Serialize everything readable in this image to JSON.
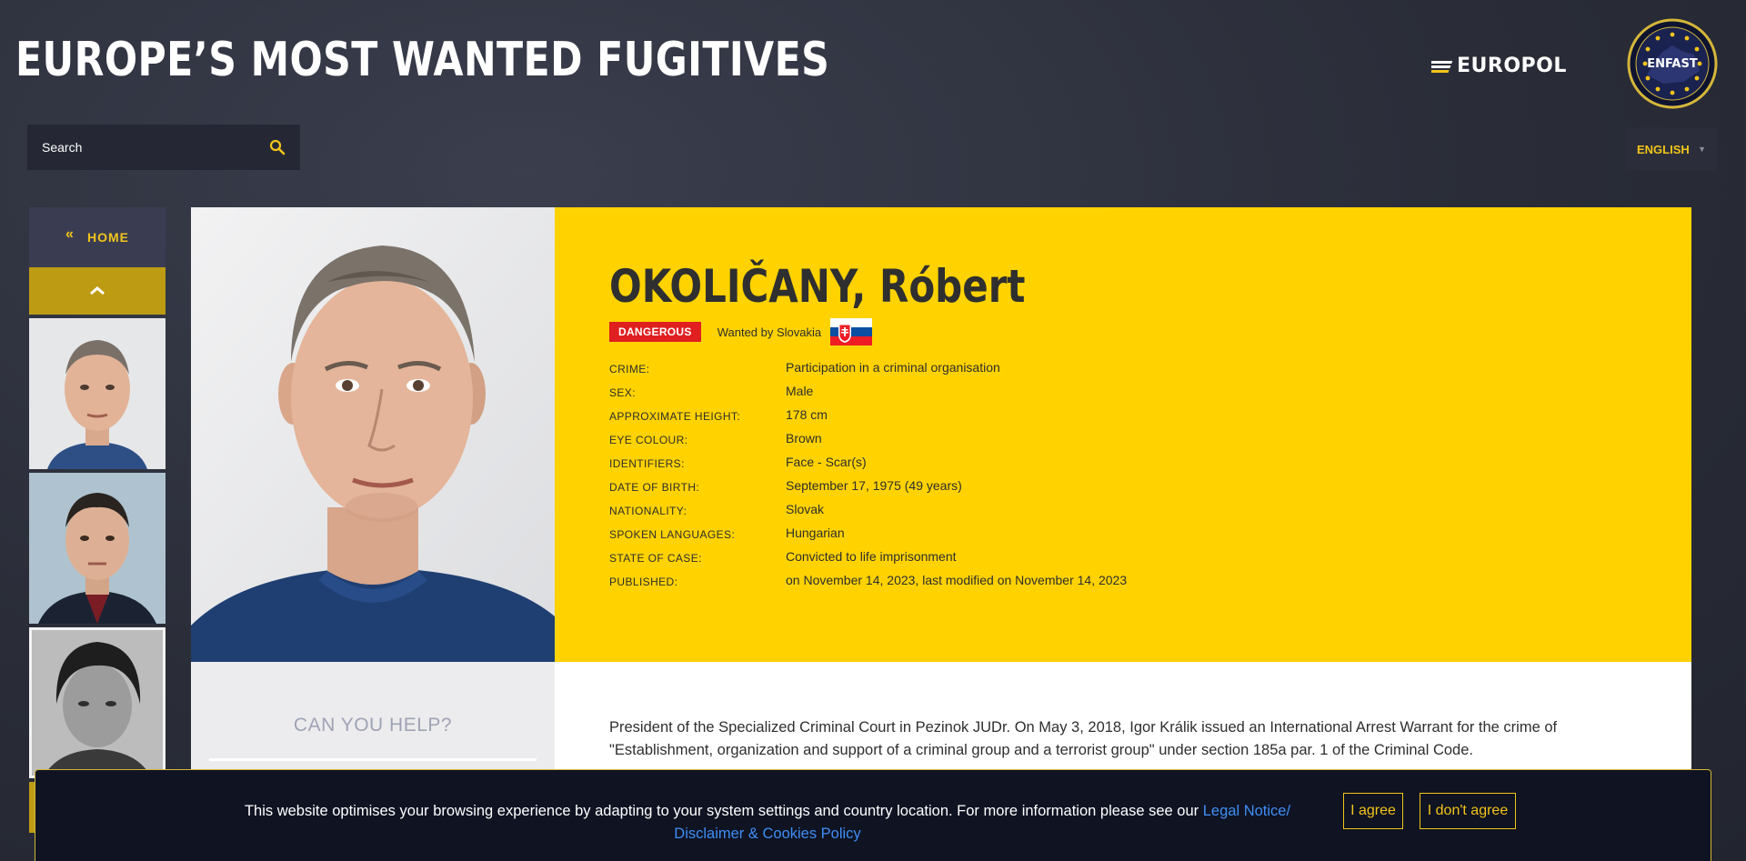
{
  "header": {
    "title": "EUROPE’S MOST WANTED FUGITIVES",
    "europol_logo_text": "EUROPOL",
    "enfast_logo_text": "ENFAST"
  },
  "search": {
    "placeholder": "Search"
  },
  "language": {
    "selected": "ENGLISH"
  },
  "sidebar": {
    "home_label": "HOME",
    "home_arrows": "«",
    "up_arrow": "︿"
  },
  "fugitive": {
    "name": "OKOLIČANY, Róbert",
    "badge": "DANGEROUS",
    "wanted_by": "Wanted by Slovakia",
    "details": [
      {
        "label": "CRIME:",
        "value": "Participation in a criminal organisation"
      },
      {
        "label": "SEX:",
        "value": "Male"
      },
      {
        "label": "APPROXIMATE HEIGHT:",
        "value": "178 cm"
      },
      {
        "label": "EYE COLOUR:",
        "value": "Brown"
      },
      {
        "label": "IDENTIFIERS:",
        "value": "Face - Scar(s)"
      },
      {
        "label": "DATE OF BIRTH:",
        "value": "September 17, 1975 (49 years)"
      },
      {
        "label": "NATIONALITY:",
        "value": "Slovak"
      },
      {
        "label": "SPOKEN LANGUAGES:",
        "value": "Hungarian"
      },
      {
        "label": "STATE OF CASE:",
        "value": "Convicted to life imprisonment"
      },
      {
        "label": "PUBLISHED:",
        "value": "on November 14, 2023, last modified on November 14, 2023"
      }
    ]
  },
  "help": {
    "title": "CAN YOU HELP?"
  },
  "description": "President of the Specialized Criminal Court in Pezinok JUDr. On May 3, 2018, Igor Králik issued an International Arrest Warrant for the crime of \"Establishment, organization and support of a criminal group and a terrorist group\" under section 185a par. 1 of the Criminal Code.",
  "cookie": {
    "text": "This website optimises your browsing experience by adapting to your system settings and country location. For more information please see our ",
    "link": "Legal Notice/ Disclaimer & Cookies Policy",
    "agree": "I agree",
    "disagree": "I don't agree"
  },
  "colors": {
    "accent_yellow": "#ffd200",
    "badge_red": "#e01f1f",
    "link_blue": "#3f8ef5",
    "dark_bg": "#2a2d38"
  }
}
